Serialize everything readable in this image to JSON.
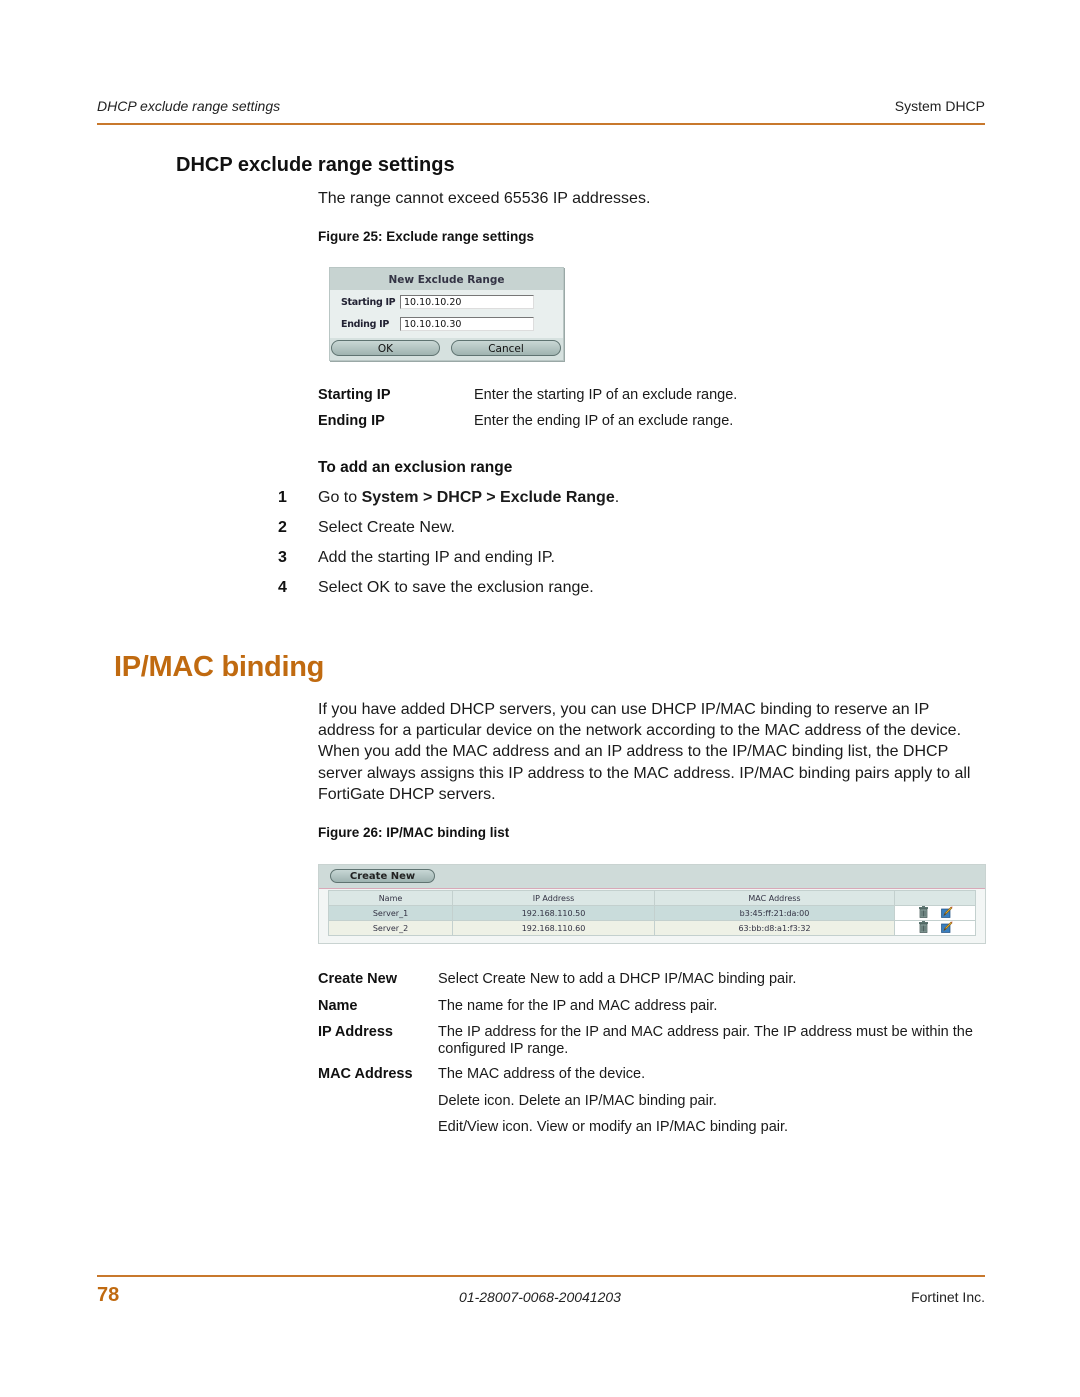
{
  "header": {
    "left": "DHCP exclude range settings",
    "right": "System DHCP"
  },
  "section1": {
    "title": "DHCP exclude range settings",
    "intro": "The range cannot exceed 65536 IP addresses.",
    "figure_caption": "Figure 25: Exclude range settings",
    "dialog": {
      "title": "New Exclude Range",
      "fields": [
        {
          "label": "Starting IP",
          "value": "10.10.10.20"
        },
        {
          "label": "Ending IP",
          "value": "10.10.10.30"
        }
      ],
      "ok_label": "OK",
      "cancel_label": "Cancel"
    },
    "definitions": [
      {
        "term": "Starting IP",
        "desc": "Enter the starting IP of an exclude range."
      },
      {
        "term": "Ending IP",
        "desc": "Enter the ending IP of an exclude range."
      }
    ],
    "procedure": {
      "title": "To add an exclusion range",
      "steps": [
        {
          "num": "1",
          "prefix": "Go to ",
          "bold": "System > DHCP > Exclude Range",
          "suffix": "."
        },
        {
          "num": "2",
          "text": "Select Create New."
        },
        {
          "num": "3",
          "text": "Add the starting IP and ending IP."
        },
        {
          "num": "4",
          "text": "Select OK to save the exclusion range."
        }
      ]
    }
  },
  "section2": {
    "title": "IP/MAC binding",
    "paragraph": "If you have added DHCP servers, you can use DHCP IP/MAC binding to reserve an IP address for a particular device on the network according to the MAC address of the device. When you add the MAC address and an IP address to the IP/MAC binding list, the DHCP server always assigns this IP address to the MAC address. IP/MAC binding pairs apply to all FortiGate DHCP servers.",
    "figure_caption": "Figure 26: IP/MAC binding list",
    "list": {
      "create_new_label": "Create New",
      "columns": [
        "Name",
        "IP Address",
        "MAC Address",
        ""
      ],
      "rows": [
        {
          "name": "Server_1",
          "ip": "192.168.110.50",
          "mac": "b3:45:ff:21:da:00",
          "icons": [
            "delete-icon",
            "edit-icon"
          ]
        },
        {
          "name": "Server_2",
          "ip": "192.168.110.60",
          "mac": "63:bb:d8:a1:f3:32",
          "icons": [
            "delete-icon",
            "edit-icon"
          ]
        }
      ]
    },
    "definitions": [
      {
        "term": "Create New",
        "desc": "Select Create New to add a DHCP IP/MAC binding pair."
      },
      {
        "term": "Name",
        "desc": "The name for the IP and MAC address pair."
      },
      {
        "term": "IP Address",
        "desc": "The IP address for the IP and MAC address pair. The IP address must be within the configured IP range."
      },
      {
        "term": "MAC Address",
        "desc": "The MAC address of the device."
      },
      {
        "term": "",
        "desc": "Delete icon. Delete an IP/MAC binding pair."
      },
      {
        "term": "",
        "desc": "Edit/View icon. View or modify an IP/MAC binding pair."
      }
    ]
  },
  "footer": {
    "page_number": "78",
    "doc_id": "01-28007-0068-20041203",
    "company": "Fortinet Inc."
  },
  "colors": {
    "accent": "#c06a10",
    "rule": "#c8782c"
  }
}
